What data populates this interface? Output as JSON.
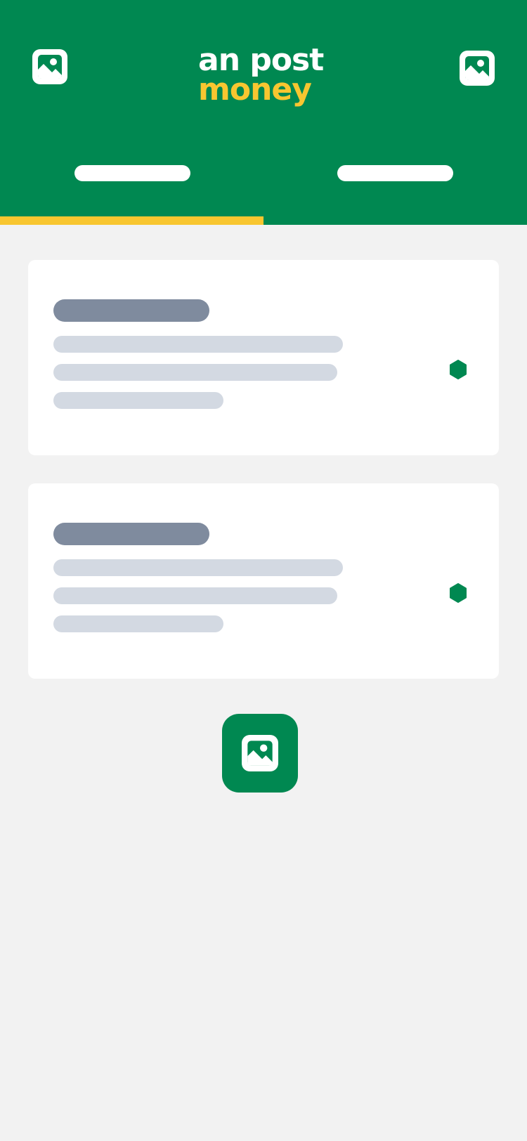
{
  "colors": {
    "brand_green": "#008851",
    "brand_yellow": "#f8c630",
    "background": "#f2f2f2",
    "card": "#ffffff",
    "skeleton_title": "#7f8b9e",
    "skeleton_line": "#d3d9e2"
  },
  "header": {
    "left_icon": "image-icon",
    "right_icon": "image-icon",
    "logo": {
      "top_text": "an post",
      "bottom_text": "money"
    }
  },
  "tabs": {
    "selected_index": 0,
    "count": 2
  },
  "cards": [
    {
      "action_icon": "hexagon-icon"
    },
    {
      "action_icon": "hexagon-icon"
    }
  ],
  "fab": {
    "icon": "image-icon"
  }
}
